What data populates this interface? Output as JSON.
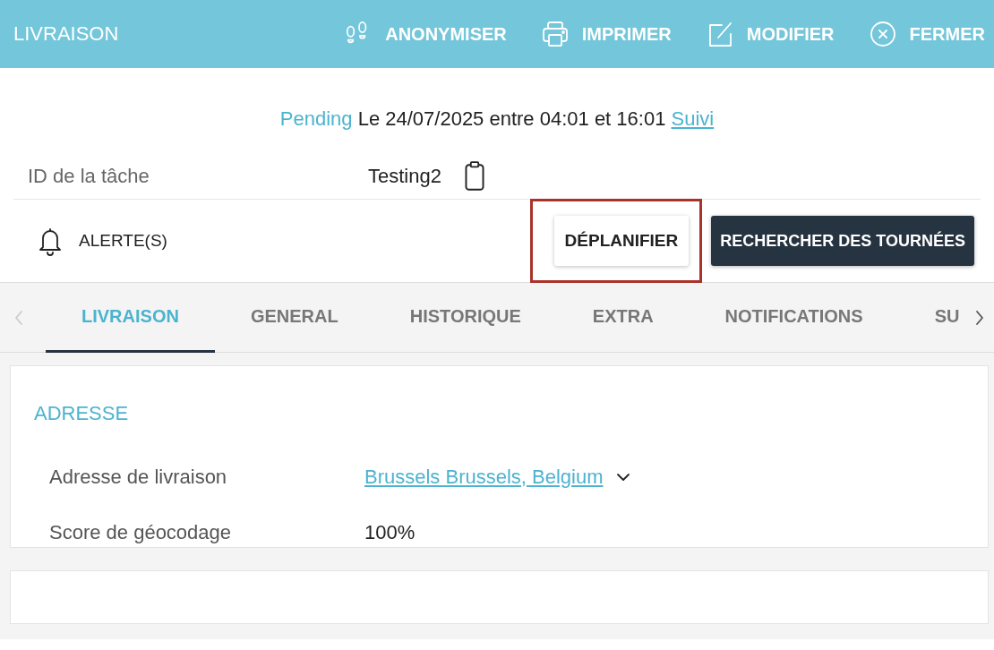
{
  "header": {
    "title": "LIVRAISON",
    "actions": [
      {
        "kind": "anonymize",
        "label": "ANONYMISER"
      },
      {
        "kind": "print",
        "label": "IMPRIMER"
      },
      {
        "kind": "edit",
        "label": "MODIFIER"
      },
      {
        "kind": "close",
        "label": "FERMER"
      }
    ]
  },
  "status_line": {
    "status": "Pending",
    "text": "Le 24/07/2025 entre 04:01 et 16:01",
    "link": "Suivi"
  },
  "task_id": {
    "label": "ID de la tâche",
    "value": "Testing2"
  },
  "alerts": {
    "label": "ALERTE(S)"
  },
  "buttons": [
    {
      "kind": "plain",
      "label": "DÉPLANIFIER",
      "highlighted": true
    },
    {
      "kind": "dark",
      "label": "RECHERCHER DES TOURNÉES",
      "highlighted": false
    }
  ],
  "tabs": {
    "prev_disabled": true,
    "next_disabled": false,
    "items": [
      {
        "label": "LIVRAISON",
        "selected": true
      },
      {
        "label": "GENERAL",
        "selected": false
      },
      {
        "label": "HISTORIQUE",
        "selected": false
      },
      {
        "label": "EXTRA",
        "selected": false
      },
      {
        "label": "NOTIFICATIONS",
        "selected": false
      },
      {
        "label": "SU",
        "selected": false
      }
    ]
  },
  "address_card": {
    "title": "ADRESSE",
    "rows": [
      {
        "kind": "link",
        "label": "Adresse de livraison",
        "value": "Brussels Brussels, Belgium"
      },
      {
        "kind": "text",
        "label": "Score de géocodage",
        "value": "100%"
      }
    ]
  }
}
